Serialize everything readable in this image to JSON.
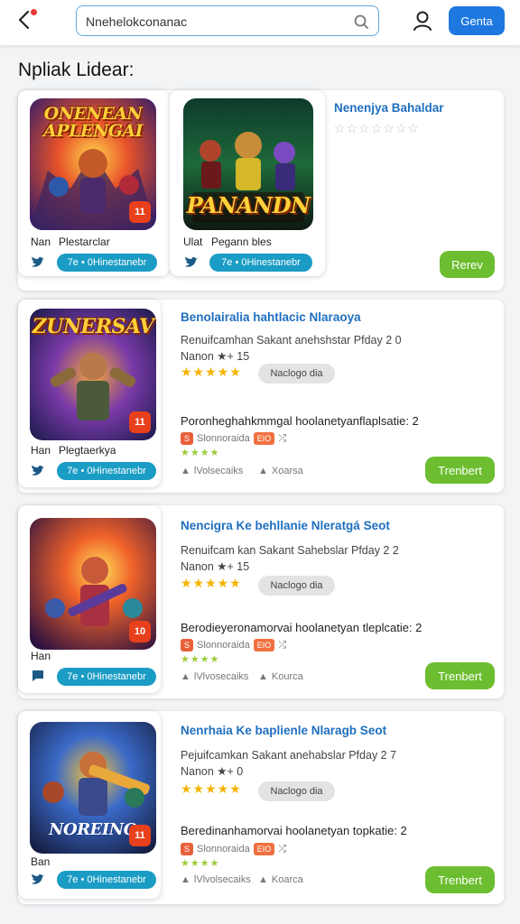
{
  "header": {
    "search_value": "Nnehelokconanac",
    "action_label": "Genta"
  },
  "section_title": "Npliak Lidear:",
  "featured": {
    "game1": {
      "art_title": "ONENEAN APLENGAI",
      "badge": "11",
      "caption_left": "Nan",
      "caption_right": "Plestarclar",
      "pill": "7e • 0Hinestanebr"
    },
    "game2": {
      "art_title": "PANANDN",
      "caption_left": "Ulat",
      "caption_right": "Pegann bles",
      "pill": "7e • 0Hinestanebr"
    },
    "side_title": "Nenenjya Bahaldar",
    "side_stars": "☆☆☆☆☆☆☆",
    "side_button": "Rerev"
  },
  "cards": [
    {
      "art_title": "ZUNERSAV",
      "badge": "11",
      "caption_left": "Han",
      "caption_right": "Plegtaerkya",
      "pill": "7e • 0Hinestanebr",
      "title": "Benolairalia hahtlacic Nlaraoya",
      "sub1": "Renuifcamhan Sakant anehshstar Pfday 2 0",
      "sub2": "Nanon ★+ 15",
      "chip": "Naclogo dia",
      "line": "Poronheghahkmmgal hoolanetyanflaplsatie: 2",
      "tag1_text": "Slonnoraida",
      "tag2_text": "EIO",
      "meta1": "lVolsecaiks",
      "meta2": "Xoarsa",
      "button": "Trenbert"
    },
    {
      "art_title": "",
      "badge": "10",
      "caption_left": "Han",
      "caption_right": "",
      "pill": "7e • 0Hinestanebr",
      "title": "Nencigra Ke behllanie Nleratgá Seot",
      "sub1": "Renuifcam kan Sakant Sahebslar Pfday 2 2",
      "sub2": "Nanon ★+ 15",
      "chip": "Naclogo dia",
      "line": "Berodieyeronamorvai hoolanetyan tleplcatie: 2",
      "tag1_text": "Slonnoraida",
      "tag2_text": "EIO",
      "meta1": "lVlvosecaiks",
      "meta2": "Kourca",
      "button": "Trenbert"
    },
    {
      "art_title": "NOREINO",
      "badge": "11",
      "caption_left": "Ban",
      "caption_right": "",
      "pill": "7e • 0Hinestanebr",
      "title": "Nenrhaia Ke baplienle Nlaragb Seot",
      "sub1": "Pejuifcamkan Sakant anehabslar Pfday 2 7",
      "sub2": "Nanon ★+ 0",
      "chip": "Naclogo dia",
      "line": "Beredinanhamorvai hoolanetyan topkatie: 2",
      "tag1_text": "Slonnoraida",
      "tag2_text": "EIO",
      "meta1": "lVlvolsecaiks",
      "meta2": "Koarca",
      "button": "Trenbert"
    }
  ],
  "colors": {
    "accent_blue": "#1e78e0",
    "title_blue": "#1f6fbf",
    "pill_teal": "#1a9cc4",
    "button_green": "#6cbd2f",
    "star_gold": "#f5b300"
  }
}
